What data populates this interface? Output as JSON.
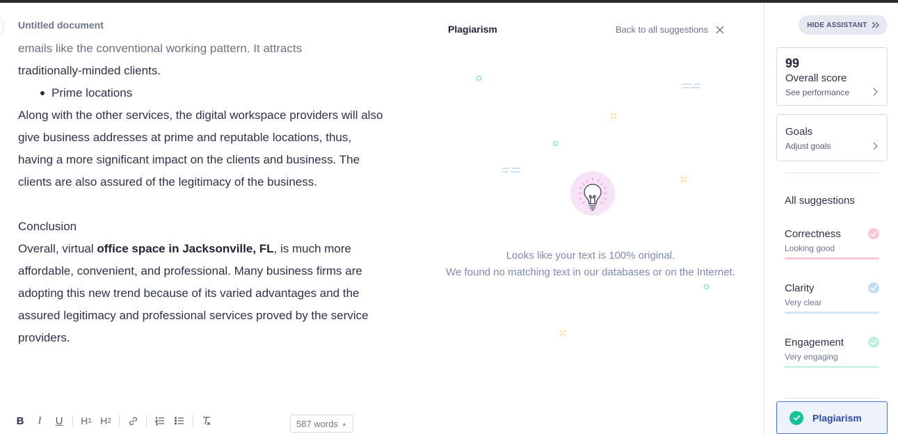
{
  "editor": {
    "doc_title": "Untitled document",
    "lines": {
      "p1a": "emails like the conventional working pattern. It attracts",
      "p1b": "traditionally-minded clients.",
      "bullet": "Prime locations",
      "p2": "Along with the other services, the digital workspace providers will also give business addresses at prime and reputable locations, thus, having a more significant impact on the clients and business. The clients are also assured of the legitimacy of the business.",
      "heading": "Conclusion",
      "p3_pre": "Overall, virtual ",
      "p3_bold": "office space in Jacksonville, FL",
      "p3_post": ", is much more affordable, convenient, and professional. Many business firms are adopting this new trend because of its varied advantages and the assured legitimacy and professional services proved by the service providers."
    },
    "toolbar": {
      "bold": "B",
      "italic": "I",
      "underline": "U",
      "h1": "H",
      "h1_sub": "1",
      "h2": "H",
      "h2_sub": "2"
    },
    "word_count": "587 words"
  },
  "plagiarism": {
    "title": "Plagiarism",
    "back_link": "Back to all suggestions",
    "message_line1": "Looks like your text is 100% original.",
    "message_line2": "We found no matching text in our databases or on the Internet."
  },
  "sidebar": {
    "hide_button": "HIDE ASSISTANT",
    "score": {
      "value": "99",
      "label": "Overall score",
      "link": "See performance"
    },
    "goals": {
      "label": "Goals",
      "link": "Adjust goals"
    },
    "all_suggestions": "All suggestions",
    "categories": [
      {
        "name": "Correctness",
        "status": "Looking good",
        "color": "#f7a1b5"
      },
      {
        "name": "Clarity",
        "status": "Very clear",
        "color": "#a9cdf2"
      },
      {
        "name": "Engagement",
        "status": "Very engaging",
        "color": "#a6e8d6"
      }
    ],
    "plagiarism_button": "Plagiarism"
  },
  "colors": {
    "accent_green": "#15c39a",
    "accent_blue": "#4a6ee0"
  },
  "icons": {
    "close": "close-icon",
    "chevron_right": "chevron-right-icon",
    "double_chevron": "double-chevron-right-icon",
    "lightbulb": "lightbulb-icon",
    "check": "check-icon",
    "link": "link-icon",
    "numbered_list": "numbered-list-icon",
    "bulleted_list": "bulleted-list-icon",
    "clear_format": "clear-formatting-icon"
  }
}
